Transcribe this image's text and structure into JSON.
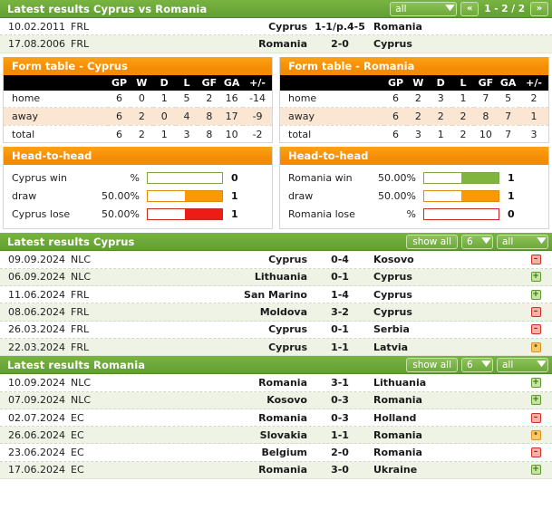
{
  "h2h_header": {
    "title": "Latest results Cyprus vs Romania",
    "filter_value": "all",
    "prev_label": "«",
    "next_label": "»",
    "page_label": "1 - 2 / 2"
  },
  "h2h_matches": [
    {
      "date": "10.02.2011",
      "comp": "FRL",
      "home": "Cyprus",
      "score": "1-1/p.4-5",
      "away": "Romania"
    },
    {
      "date": "17.08.2006",
      "comp": "FRL",
      "home": "Romania",
      "score": "2-0",
      "away": "Cyprus"
    }
  ],
  "form_tables": [
    {
      "title": "Form table - Cyprus",
      "columns": [
        "",
        "GP",
        "W",
        "D",
        "L",
        "GF",
        "GA",
        "+/-"
      ],
      "rows": [
        {
          "label": "home",
          "gp": "6",
          "w": "0",
          "d": "1",
          "l": "5",
          "gf": "2",
          "ga": "16",
          "diff": "-14"
        },
        {
          "label": "away",
          "gp": "6",
          "w": "2",
          "d": "0",
          "l": "4",
          "gf": "8",
          "ga": "17",
          "diff": "-9"
        },
        {
          "label": "total",
          "gp": "6",
          "w": "2",
          "d": "1",
          "l": "3",
          "gf": "8",
          "ga": "10",
          "diff": "-2"
        }
      ]
    },
    {
      "title": "Form table - Romania",
      "columns": [
        "",
        "GP",
        "W",
        "D",
        "L",
        "GF",
        "GA",
        "+/-"
      ],
      "rows": [
        {
          "label": "home",
          "gp": "6",
          "w": "2",
          "d": "3",
          "l": "1",
          "gf": "7",
          "ga": "5",
          "diff": "2"
        },
        {
          "label": "away",
          "gp": "6",
          "w": "2",
          "d": "2",
          "l": "2",
          "gf": "8",
          "ga": "7",
          "diff": "1"
        },
        {
          "label": "total",
          "gp": "6",
          "w": "3",
          "d": "1",
          "l": "2",
          "gf": "10",
          "ga": "7",
          "diff": "3"
        }
      ]
    }
  ],
  "head_to_head": [
    {
      "title": "Head-to-head",
      "rows": [
        {
          "label": "Cyprus win",
          "pct": "%",
          "fill": 0,
          "count": "0",
          "kind": "win"
        },
        {
          "label": "draw",
          "pct": "50.00%",
          "fill": 50,
          "count": "1",
          "kind": "draw"
        },
        {
          "label": "Cyprus lose",
          "pct": "50.00%",
          "fill": 50,
          "count": "1",
          "kind": "lose"
        }
      ]
    },
    {
      "title": "Head-to-head",
      "rows": [
        {
          "label": "Romania win",
          "pct": "50.00%",
          "fill": 50,
          "count": "1",
          "kind": "win"
        },
        {
          "label": "draw",
          "pct": "50.00%",
          "fill": 50,
          "count": "1",
          "kind": "draw"
        },
        {
          "label": "Romania lose",
          "pct": "%",
          "fill": 0,
          "count": "0",
          "kind": "lose"
        }
      ]
    }
  ],
  "latest_cyprus": {
    "title": "Latest results Cyprus",
    "show_all_label": "show all",
    "count_value": "6",
    "comp_value": "all",
    "matches": [
      {
        "date": "09.09.2024",
        "comp": "NLC",
        "home": "Cyprus",
        "score": "0-4",
        "away": "Kosovo",
        "result": "lose"
      },
      {
        "date": "06.09.2024",
        "comp": "NLC",
        "home": "Lithuania",
        "score": "0-1",
        "away": "Cyprus",
        "result": "win"
      },
      {
        "date": "11.06.2024",
        "comp": "FRL",
        "home": "San Marino",
        "score": "1-4",
        "away": "Cyprus",
        "result": "win"
      },
      {
        "date": "08.06.2024",
        "comp": "FRL",
        "home": "Moldova",
        "score": "3-2",
        "away": "Cyprus",
        "result": "lose"
      },
      {
        "date": "26.03.2024",
        "comp": "FRL",
        "home": "Cyprus",
        "score": "0-1",
        "away": "Serbia",
        "result": "lose"
      },
      {
        "date": "22.03.2024",
        "comp": "FRL",
        "home": "Cyprus",
        "score": "1-1",
        "away": "Latvia",
        "result": "draw"
      }
    ]
  },
  "latest_romania": {
    "title": "Latest results Romania",
    "show_all_label": "show all",
    "count_value": "6",
    "comp_value": "all",
    "matches": [
      {
        "date": "10.09.2024",
        "comp": "NLC",
        "home": "Romania",
        "score": "3-1",
        "away": "Lithuania",
        "result": "win"
      },
      {
        "date": "07.09.2024",
        "comp": "NLC",
        "home": "Kosovo",
        "score": "0-3",
        "away": "Romania",
        "result": "win"
      },
      {
        "date": "02.07.2024",
        "comp": "EC",
        "home": "Romania",
        "score": "0-3",
        "away": "Holland",
        "result": "lose"
      },
      {
        "date": "26.06.2024",
        "comp": "EC",
        "home": "Slovakia",
        "score": "1-1",
        "away": "Romania",
        "result": "draw"
      },
      {
        "date": "23.06.2024",
        "comp": "EC",
        "home": "Belgium",
        "score": "2-0",
        "away": "Romania",
        "result": "lose"
      },
      {
        "date": "17.06.2024",
        "comp": "EC",
        "home": "Romania",
        "score": "3-0",
        "away": "Ukraine",
        "result": "win"
      }
    ]
  },
  "icons": {
    "win": "+",
    "lose": "–",
    "draw": "•",
    "chevron_down": "▼"
  },
  "colors": {
    "green_header": "#6ba839",
    "orange_header": "#f68d06",
    "win": "#7fb53f",
    "draw": "#fb9a00",
    "lose": "#ed1c16"
  }
}
